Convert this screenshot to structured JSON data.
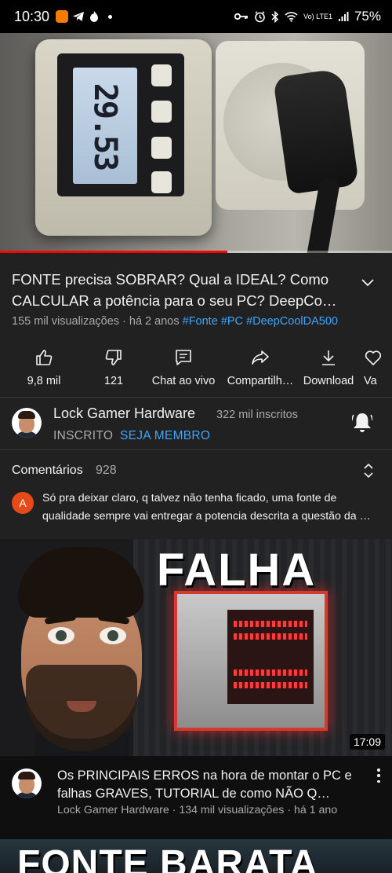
{
  "status_bar": {
    "time": "10:30",
    "battery": "75%",
    "network": "Vo) LTE1"
  },
  "player": {
    "meter_reading": "29.53",
    "progress_fraction": 0.58
  },
  "video": {
    "title": "FONTE precisa SOBRAR? Qual a IDEAL? Como CALCULAR a potência para o seu PC? DeepCo…",
    "views": "155 mil visualizações · há 2 anos",
    "hashtags": [
      "#Fonte",
      "#PC",
      "#DeepCoolDA500"
    ]
  },
  "actions": [
    {
      "label": "9,8 mil",
      "icon": "thumbs-up-icon"
    },
    {
      "label": "121",
      "icon": "thumbs-down-icon"
    },
    {
      "label": "Chat ao vivo",
      "icon": "chat-icon"
    },
    {
      "label": "Compartilh…",
      "icon": "share-icon"
    },
    {
      "label": "Download",
      "icon": "download-icon"
    },
    {
      "label": "Va",
      "icon": "heart-icon"
    }
  ],
  "channel": {
    "name": "Lock Gamer Hardware",
    "subscribers": "322 mil inscritos",
    "subscribed_label": "INSCRITO",
    "member_label": "SEJA MEMBRO"
  },
  "comments": {
    "title": "Comentários",
    "count": "928",
    "top_avatar_letter": "A",
    "top_comment": "Só pra deixar claro, q talvez não tenha ficado, uma fonte de qualidade sempre vai entregar a potencia descrita a questão da …"
  },
  "recommended": [
    {
      "thumb_text": "FALHA",
      "duration": "17:09",
      "title": "Os PRINCIPAIS ERROS na hora de montar o PC e falhas GRAVES, TUTORIAL de como NÃO Q…",
      "meta": "Lock Gamer Hardware · 134 mil visualizações · há 1 ano"
    },
    {
      "thumb_text": "FONTE BARATA"
    }
  ],
  "colors": {
    "background": "#0f0f0f",
    "panel": "#212121",
    "link_blue": "#3ea6ff",
    "progress_red": "#ff0000",
    "secondary_text": "#aaaaaa"
  }
}
